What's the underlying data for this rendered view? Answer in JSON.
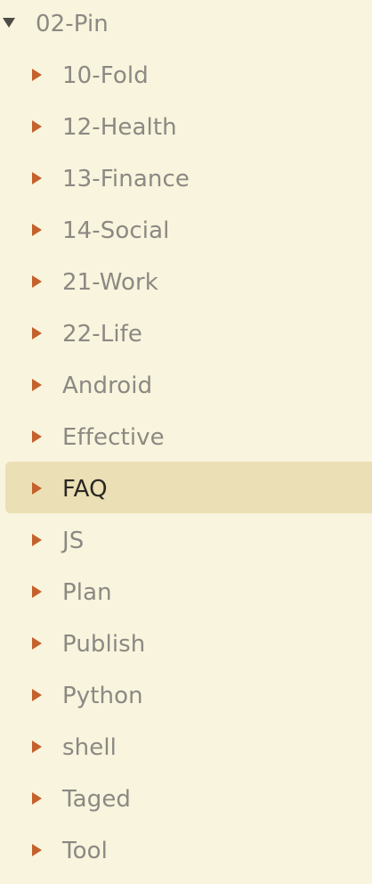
{
  "tree": {
    "root": {
      "label": "02-Pin",
      "expanded": true,
      "icon": "caret-down-icon"
    },
    "children": [
      {
        "label": "10-Fold",
        "icon": "caret-right-icon"
      },
      {
        "label": "12-Health",
        "icon": "caret-right-icon"
      },
      {
        "label": "13-Finance",
        "icon": "caret-right-icon"
      },
      {
        "label": "14-Social",
        "icon": "caret-right-icon"
      },
      {
        "label": "21-Work",
        "icon": "caret-right-icon"
      },
      {
        "label": "22-Life",
        "icon": "caret-right-icon"
      },
      {
        "label": "Android",
        "icon": "caret-right-icon"
      },
      {
        "label": "Effective",
        "icon": "caret-right-icon"
      },
      {
        "label": "FAQ",
        "icon": "caret-right-icon",
        "selected": true
      },
      {
        "label": "JS",
        "icon": "caret-right-icon"
      },
      {
        "label": "Plan",
        "icon": "caret-right-icon"
      },
      {
        "label": "Publish",
        "icon": "caret-right-icon"
      },
      {
        "label": "Python",
        "icon": "caret-right-icon"
      },
      {
        "label": "shell",
        "icon": "caret-right-icon"
      },
      {
        "label": "Taged",
        "icon": "caret-right-icon"
      },
      {
        "label": "Tool",
        "icon": "caret-right-icon"
      }
    ]
  },
  "colors": {
    "background": "#f9f4dd",
    "selected_background": "#ebdfb5",
    "caret_collapsed": "#c4612c",
    "caret_expanded": "#4e4c46",
    "text": "#8b8983",
    "selected_text": "#2a2823"
  }
}
